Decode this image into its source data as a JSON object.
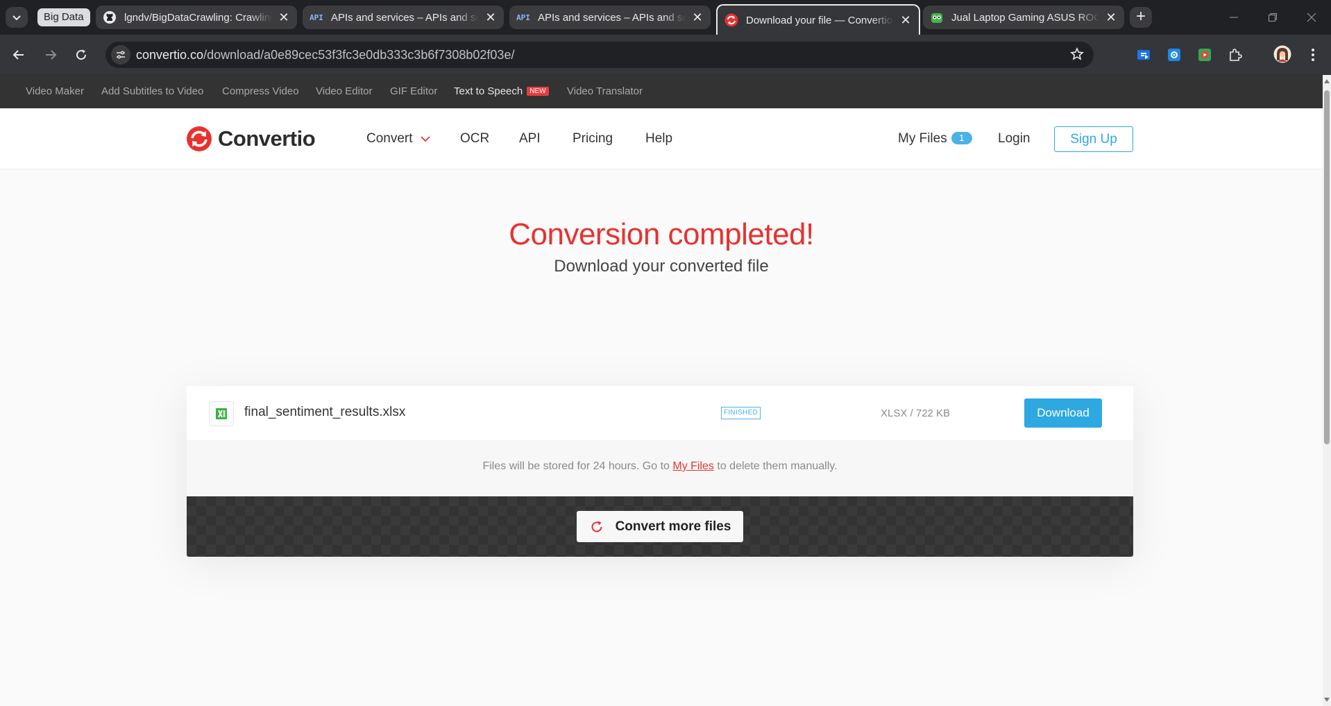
{
  "browser": {
    "group_label": "Big Data",
    "tabs": [
      {
        "title": "lgndv/BigDataCrawling: Crawling",
        "icon": "github-icon"
      },
      {
        "title": "APIs and services – APIs and services",
        "icon": "api-icon"
      },
      {
        "title": "APIs and services – APIs and services",
        "icon": "api-icon"
      },
      {
        "title": "Download your file — Convertio",
        "icon": "convertio-icon"
      },
      {
        "title": "Jual Laptop Gaming ASUS ROG",
        "icon": "tokopedia-icon"
      }
    ],
    "api_icon_text": "API",
    "new_tab_symbol": "+",
    "url_host": "convertio.co",
    "url_path": "/download/a0e89cec53f3fc3e0db333c3b6f7308b02f03e/"
  },
  "subnav": {
    "items": [
      "Video Maker",
      "Add Subtitles to Video",
      "Compress Video",
      "Video Editor",
      "GIF Editor",
      "Text to Speech",
      "Video Translator"
    ],
    "new_badge": "NEW"
  },
  "header": {
    "logo_text": "Convertio",
    "nav": {
      "convert": "Convert",
      "ocr": "OCR",
      "api": "API",
      "pricing": "Pricing",
      "help": "Help"
    },
    "my_files": "My Files",
    "my_files_count": "1",
    "login": "Login",
    "signup": "Sign Up"
  },
  "main": {
    "title": "Conversion completed!",
    "subtitle": "Download your converted file",
    "file": {
      "name": "final_sentiment_results.xlsx",
      "status": "FINISHED",
      "meta": "XLSX / 722 KB",
      "download_label": "Download"
    },
    "note_before": "Files will be stored for 24 hours. Go to ",
    "note_link": "My Files",
    "note_after": " to delete them manually.",
    "convert_more": "Convert more files"
  },
  "colors": {
    "brand_red": "#e7322f",
    "accent_blue": "#2ea8e0",
    "excel_green": "#3cb043"
  }
}
